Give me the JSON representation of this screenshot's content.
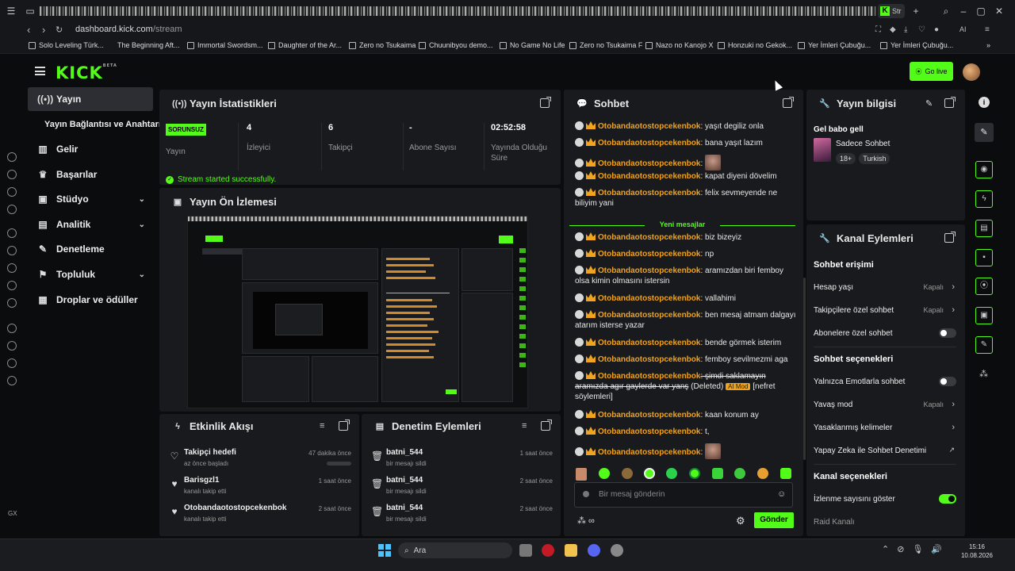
{
  "browser": {
    "active_tab_label": "Str",
    "url_domain": "dashboard.kick.com",
    "url_path": "/stream",
    "bookmarks": [
      "Solo Leveling Türk...",
      "The Beginning Aft...",
      "Immortal Swordsm...",
      "Daughter of the Ar...",
      "Zero no Tsukaima",
      "Chuunibyou demo...",
      "No Game No Life",
      "Zero no Tsukaima F",
      "Nazo no Kanojo X",
      "Honzuki no Gekok...",
      "Yer İmleri Çubuğu...",
      "Yer İmleri Çubuğu..."
    ]
  },
  "header": {
    "logo": "KICK",
    "logo_sup": "BETA",
    "go_live": "Go live"
  },
  "sidebar": {
    "items": [
      {
        "label": "Yayın"
      },
      {
        "label": "Yayın Bağlantısı ve Anahtarı"
      },
      {
        "label": "Gelir"
      },
      {
        "label": "Başarılar"
      },
      {
        "label": "Stüdyo"
      },
      {
        "label": "Analitik"
      },
      {
        "label": "Denetleme"
      },
      {
        "label": "Topluluk"
      },
      {
        "label": "Droplar ve ödüller"
      }
    ]
  },
  "stats_panel": {
    "title": "Yayın İstatistikleri",
    "status_badge": "SORUNSUZ",
    "status_label": "Yayın",
    "viewers_value": "4",
    "viewers_label": "İzleyici",
    "followers_value": "6",
    "followers_label": "Takipçi",
    "subs_value": "-",
    "subs_label": "Abone Sayısı",
    "duration_value": "02:52:58",
    "duration_label": "Yayında Olduğu Süre",
    "success_msg": "Stream started successfully."
  },
  "preview_panel": {
    "title": "Yayın Ön İzlemesi"
  },
  "activity_panel": {
    "title": "Etkinlik Akışı",
    "items": [
      {
        "title": "Takipçi hedefi",
        "sub": "az önce başladı",
        "time": "47 dakika önce"
      },
      {
        "title": "Barisgzl1",
        "sub": "kanalı takip etti",
        "time": "1 saat önce"
      },
      {
        "title": "Otobandaotostopcekenbok",
        "sub": "kanalı takip etti",
        "time": "2 saat önce"
      }
    ]
  },
  "moderation_panel": {
    "title": "Denetim Eylemleri",
    "items": [
      {
        "title": "batni_544",
        "sub": "bir mesajı sildi",
        "time": "1 saat önce"
      },
      {
        "title": "batni_544",
        "sub": "bir mesajı sildi",
        "time": "2 saat önce"
      },
      {
        "title": "batni_544",
        "sub": "bir mesajı sildi",
        "time": "2 saat önce"
      }
    ]
  },
  "chat": {
    "title": "Sohbet",
    "username": "Otobandaotostopcekenbok",
    "new_messages": "Yeni mesajlar",
    "messages": [
      {
        "text": ": yaşıt degiliz onla"
      },
      {
        "text": ": bana yaşıt lazım"
      },
      {
        "text": ":",
        "emote": true
      },
      {
        "text": ": kapat diyeni dövelim"
      },
      {
        "text": ": felix sevmeyende ne biliyim yani"
      },
      {
        "text": ": biz bizeyiz"
      },
      {
        "text": ": np"
      },
      {
        "text": ": aramızdan biri femboy olsa kimin olmasını istersin"
      },
      {
        "text": ": vallahimi"
      },
      {
        "text": ": ben mesaj atmam dalgayı atarım isterse yazar"
      },
      {
        "text": ": bende görmek isterim"
      },
      {
        "text": ": femboy sevilmezmi aga"
      },
      {
        "text": ": şimdi saklamayın aramızda agır gaylerde var yanş",
        "deleted": "(Deleted)",
        "badge": "AI Mod",
        "suffix": "[nefret söylemleri]"
      },
      {
        "text": ": kaan konum ay"
      },
      {
        "text": ": t,"
      },
      {
        "text": ":",
        "emote": true
      }
    ],
    "input_placeholder": "Bir mesaj gönderin",
    "send_label": "Gönder"
  },
  "stream_info": {
    "title": "Yayın bilgisi",
    "stream_title": "Gel babo gell",
    "category": "Sadece Sohbet",
    "tags": [
      "18+",
      "Turkish"
    ]
  },
  "channel_actions": {
    "title": "Kanal Eylemleri",
    "chat_access_heading": "Sohbet erişimi",
    "account_age": "Hesap yaşı",
    "account_age_value": "Kapalı",
    "followers_only": "Takipçilere özel sohbet",
    "followers_only_value": "Kapalı",
    "subs_only": "Abonelere özel sohbet",
    "chat_options_heading": "Sohbet seçenekleri",
    "emotes_only": "Yalnızca Emotlarla sohbet",
    "slow_mode": "Yavaş mod",
    "slow_mode_value": "Kapalı",
    "banned_words": "Yasaklanmış kelimeler",
    "ai_moderation": "Yapay Zeka ile Sohbet Denetimi",
    "channel_options_heading": "Kanal seçenekleri",
    "show_viewer_count": "İzlenme sayısını göster",
    "raid_channel": "Raid Kanalı"
  },
  "taskbar": {
    "search_label": "Ara",
    "time": "15:16",
    "date": "10.08.2026"
  },
  "colors": {
    "accent": "#53fc18",
    "username": "#f0a21c",
    "bg": "#0b0c0e",
    "panel": "#191a1d"
  }
}
